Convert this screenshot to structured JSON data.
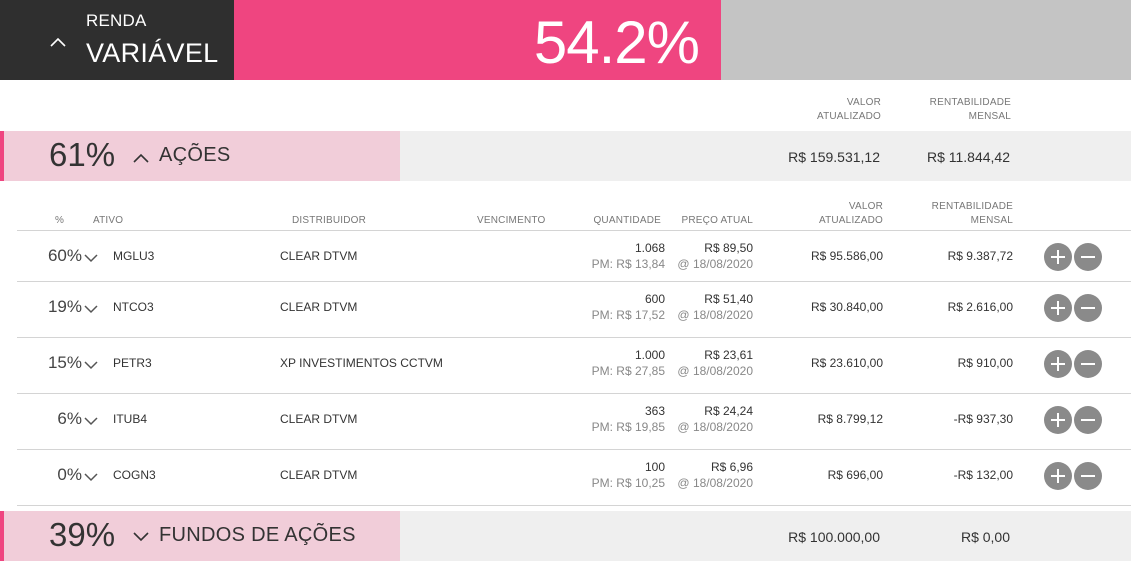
{
  "header": {
    "line1": "RENDA",
    "line2": "VARIÁVEL",
    "percent": "54.2%",
    "chevron_icon": "chevron-up-icon"
  },
  "summary_columns": {
    "valor_1": "VALOR",
    "valor_2": "ATUALIZADO",
    "rent_1": "RENTABILIDADE",
    "rent_2": "MENSAL"
  },
  "sections": [
    {
      "percent": "61%",
      "name": "AÇÕES",
      "expanded": true,
      "valor": "R$ 159.531,12",
      "rentabilidade": "R$ 11.844,42"
    },
    {
      "percent": "39%",
      "name": "FUNDOS DE AÇÕES",
      "expanded": false,
      "valor": "R$ 100.000,00",
      "rentabilidade": "R$ 0,00"
    }
  ],
  "table": {
    "columns": {
      "pct": "%",
      "ativo": "ATIVO",
      "distribuidor": "DISTRIBUIDOR",
      "vencimento": "VENCIMENTO",
      "quantidade": "QUANTIDADE",
      "preco": "PREÇO ATUAL",
      "valor_1": "VALOR",
      "valor_2": "ATUALIZADO",
      "rent_1": "RENTABILIDADE",
      "rent_2": "MENSAL"
    },
    "rows": [
      {
        "pct": "60%",
        "ticker": "MGLU3",
        "distribuidor": "CLEAR DTVM",
        "quantidade": "1.068",
        "pm": "PM: R$ 13,84",
        "preco": "R$ 89,50",
        "data": "@ 18/08/2020",
        "valor": "R$ 95.586,00",
        "rentabilidade": "R$ 9.387,72"
      },
      {
        "pct": "19%",
        "ticker": "NTCO3",
        "distribuidor": "CLEAR DTVM",
        "quantidade": "600",
        "pm": "PM: R$ 17,52",
        "preco": "R$ 51,40",
        "data": "@ 18/08/2020",
        "valor": "R$ 30.840,00",
        "rentabilidade": "R$ 2.616,00"
      },
      {
        "pct": "15%",
        "ticker": "PETR3",
        "distribuidor": "XP INVESTIMENTOS CCTVM",
        "quantidade": "1.000",
        "pm": "PM: R$ 27,85",
        "preco": "R$ 23,61",
        "data": "@ 18/08/2020",
        "valor": "R$ 23.610,00",
        "rentabilidade": "R$ 910,00"
      },
      {
        "pct": "6%",
        "ticker": "ITUB4",
        "distribuidor": "CLEAR DTVM",
        "quantidade": "363",
        "pm": "PM: R$ 19,85",
        "preco": "R$ 24,24",
        "data": "@ 18/08/2020",
        "valor": "R$ 8.799,12",
        "rentabilidade": "-R$ 937,30"
      },
      {
        "pct": "0%",
        "ticker": "COGN3",
        "distribuidor": "CLEAR DTVM",
        "quantidade": "100",
        "pm": "PM: R$ 10,25",
        "preco": "R$ 6,96",
        "data": "@ 18/08/2020",
        "valor": "R$ 696,00",
        "rentabilidade": "-R$ 132,00"
      }
    ]
  },
  "colors": {
    "accent": "#ef4580",
    "header_dark": "#2f2f2f",
    "header_gray": "#c4c4c4",
    "section_pink": "#f1cdd9",
    "section_gray": "#efefef",
    "action_button": "#8a8a8a"
  },
  "icons": {
    "row_expand": "chevron-down-icon",
    "add": "plus-circle-icon",
    "remove": "minus-circle-icon"
  }
}
